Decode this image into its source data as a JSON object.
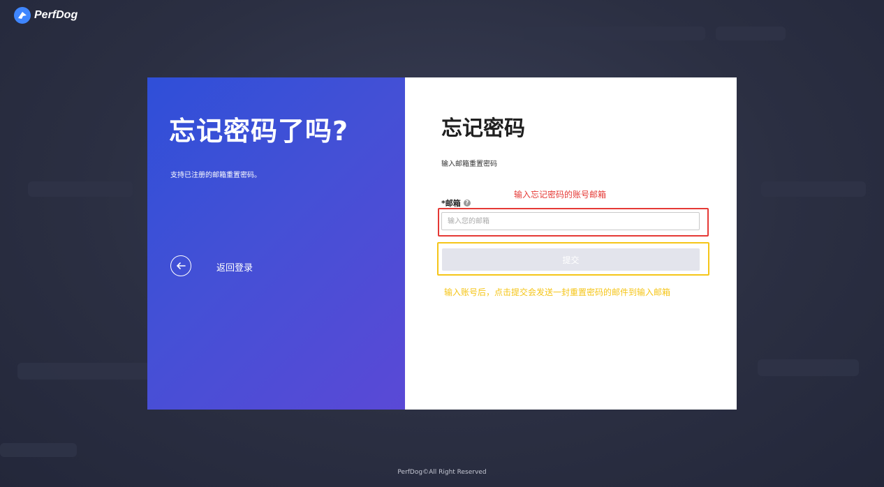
{
  "brand": {
    "name": "PerfDog",
    "icon": "perfdog-logo-icon"
  },
  "left_panel": {
    "title": "忘记密码了吗?",
    "subtitle": "支持已注册的邮箱重置密码。",
    "back_label": "返回登录",
    "back_icon": "arrow-left-icon"
  },
  "form": {
    "title": "忘记密码",
    "description": "输入邮箱重置密码",
    "email_label": "*邮箱",
    "email_help_icon": "question-circle-icon",
    "email_placeholder": "输入您的邮箱",
    "email_value": "",
    "submit_label": "提交"
  },
  "annotations": {
    "email_note": "输入忘记密码的账号邮箱",
    "submit_note": "输入账号后，点击提交会发送一封重置密码的邮件到输入邮箱"
  },
  "footer": {
    "text": "PerfDog©All Right Reserved"
  },
  "colors": {
    "background": "#2b2f42",
    "panel_gradient_start": "#2f4fd8",
    "panel_gradient_end": "#5a49d6",
    "submit_disabled": "#e3e4ec",
    "annotation_red": "#e53935",
    "annotation_yellow": "#f5c518"
  }
}
